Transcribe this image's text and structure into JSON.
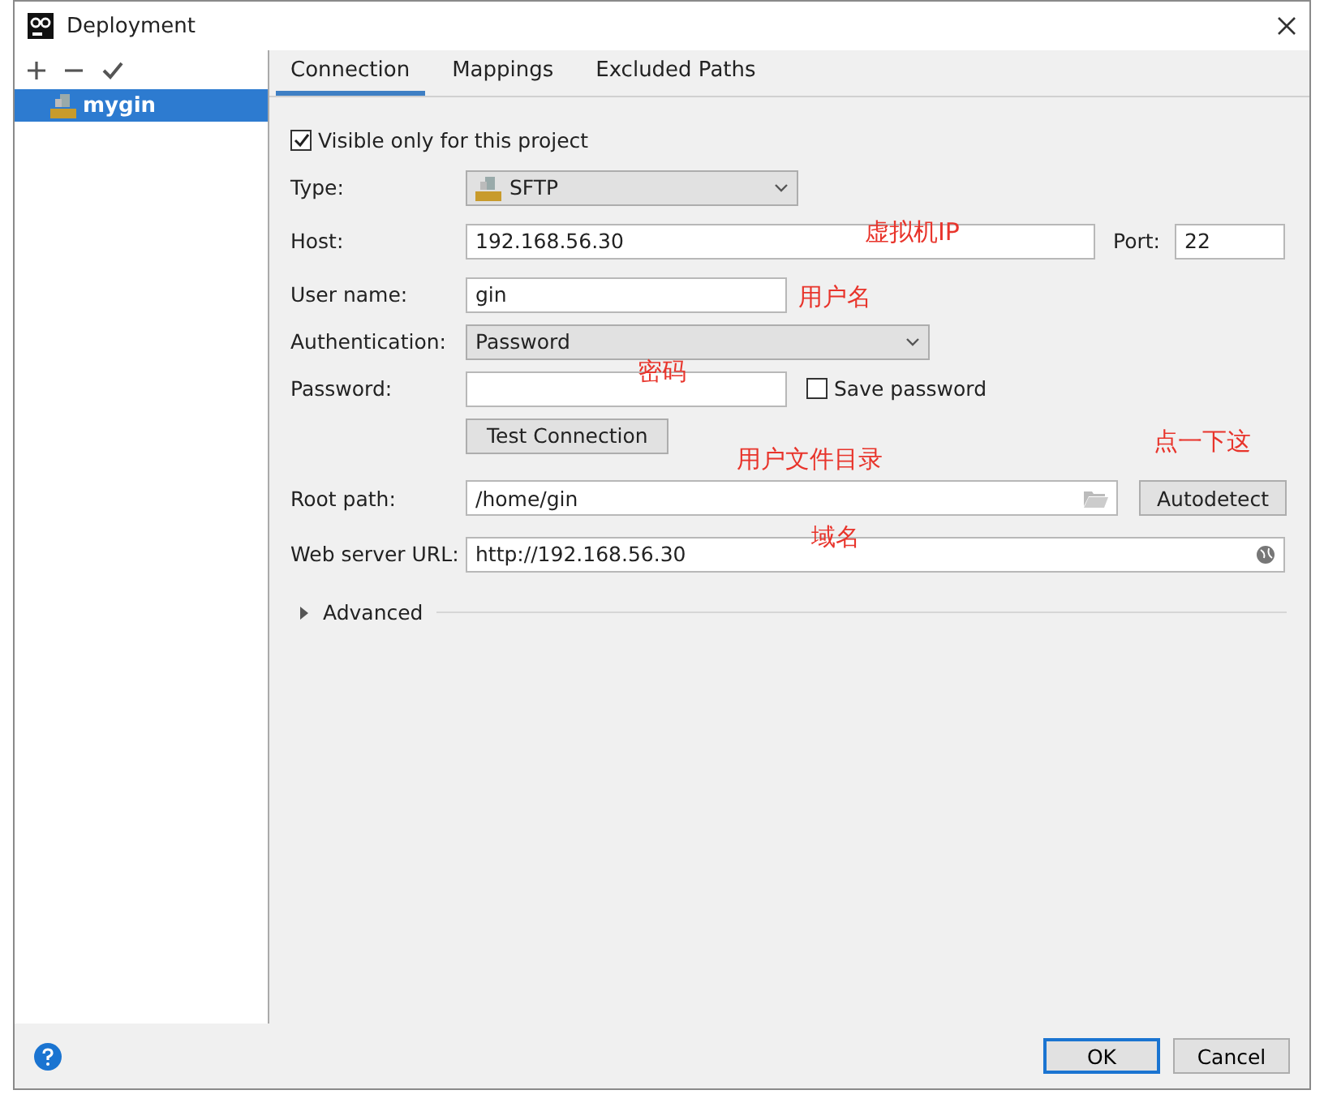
{
  "window": {
    "title": "Deployment"
  },
  "sidebar": {
    "items": [
      {
        "label": "mygin",
        "selected": true
      }
    ]
  },
  "tabs": [
    {
      "label": "Connection",
      "selected": true
    },
    {
      "label": "Mappings",
      "selected": false
    },
    {
      "label": "Excluded Paths",
      "selected": false
    }
  ],
  "visible_only": {
    "label": "Visible only for this project",
    "checked": true
  },
  "type": {
    "label": "Type:",
    "value": "SFTP"
  },
  "host": {
    "label": "Host:",
    "value": "192.168.56.30",
    "port_label": "Port:",
    "port": "22"
  },
  "user_name": {
    "label": "User name:",
    "value": "gin"
  },
  "authentication": {
    "label": "Authentication:",
    "value": "Password"
  },
  "password": {
    "label": "Password:",
    "save_label": "Save password",
    "save_checked": false
  },
  "test_button": "Test Connection",
  "root_path": {
    "label": "Root path:",
    "value": "/home/gin",
    "button": "Autodetect"
  },
  "web_server_url": {
    "label": "Web server URL:",
    "value": "http://192.168.56.30"
  },
  "advanced": {
    "label": "Advanced",
    "expanded": false
  },
  "annotations": [
    "虚拟机IP",
    "用户名",
    "密码",
    "点一下这",
    "用户文件目录",
    "域名"
  ],
  "buttons": [
    {
      "label": "OK",
      "default": true
    },
    {
      "label": "Cancel",
      "default": false
    }
  ]
}
